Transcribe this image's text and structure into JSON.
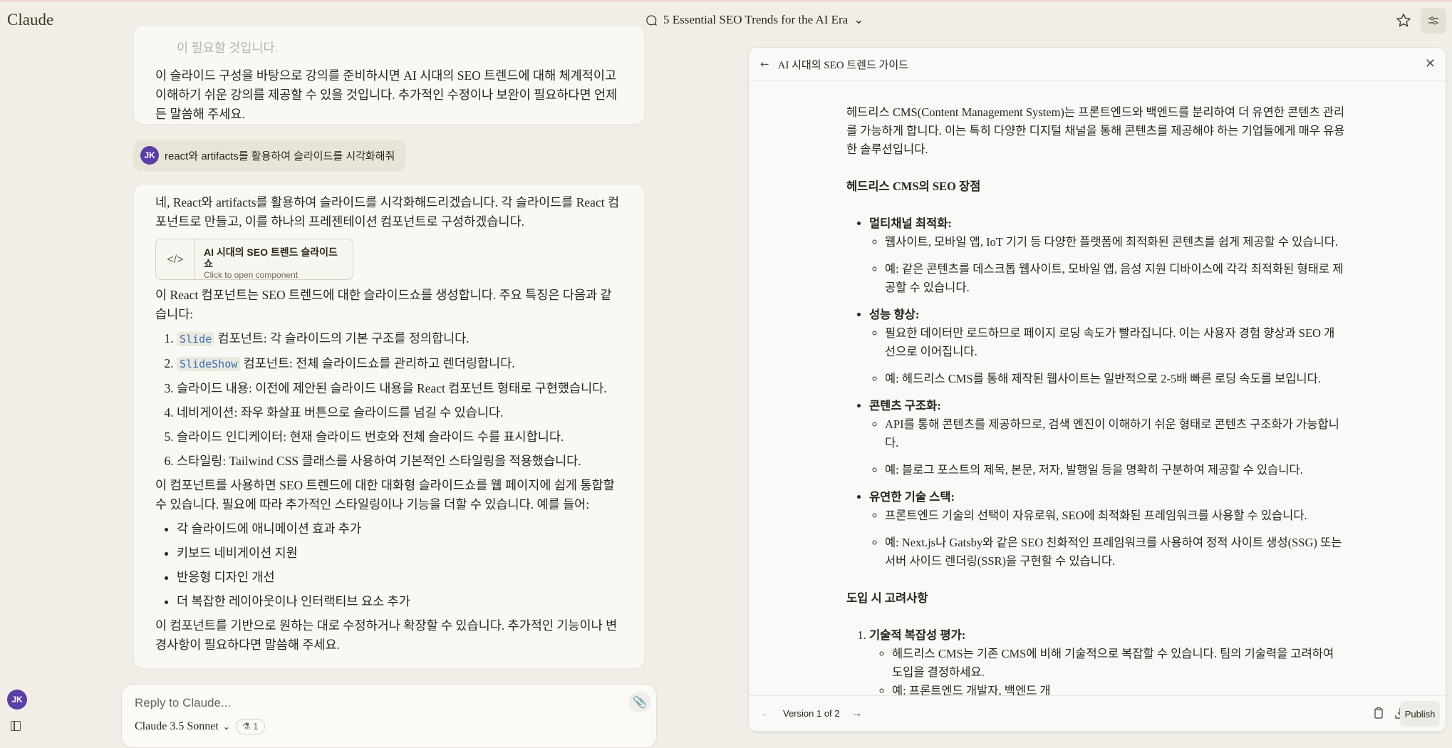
{
  "app": {
    "logo": "Claude",
    "conversation_title": "5 Essential SEO Trends for the AI Era",
    "user_initials": "JK"
  },
  "chat": {
    "prev_faded": "이 필요할 것입니다.",
    "prev_text": "이 슬라이드 구성을 바탕으로 강의를 준비하시면 AI 시대의 SEO 트렌드에 대해 체계적이고 이해하기 쉬운 강의를 제공할 수 있을 것입니다. 추가적인 수정이나 보완이 필요하다면 언제든 말씀해 주세요.",
    "user_message": "react와 artifacts를 활용하여 슬라이드를 시각화해줘",
    "reply_intro": "네, React와 artifacts를 활용하여 슬라이드를 시각화해드리겠습니다. 각 슬라이드를 React 컴포넌트로 만들고, 이를 하나의 프레젠테이션 컴포넌트로 구성하겠습니다.",
    "artifact": {
      "title": "AI 시대의 SEO 트렌드 슬라이드쇼",
      "subtitle": "Click to open component"
    },
    "features_intro": "이 React 컴포넌트는 SEO 트렌드에 대한 슬라이드쇼를 생성합니다. 주요 특징은 다음과 같습니다:",
    "features": [
      {
        "code": "Slide",
        "text": " 컴포넌트: 각 슬라이드의 기본 구조를 정의합니다."
      },
      {
        "code": "SlideShow",
        "text": " 컴포넌트: 전체 슬라이드쇼를 관리하고 렌더링합니다."
      },
      {
        "code": "",
        "text": "슬라이드 내용: 이전에 제안된 슬라이드 내용을 React 컴포넌트 형태로 구현했습니다."
      },
      {
        "code": "",
        "text": "네비게이션: 좌우 화살표 버튼으로 슬라이드를 넘길 수 있습니다."
      },
      {
        "code": "",
        "text": "슬라이드 인디케이터: 현재 슬라이드 번호와 전체 슬라이드 수를 표시합니다."
      },
      {
        "code": "",
        "text": "스타일링: Tailwind CSS 클래스를 사용하여 기본적인 스타일링을 적용했습니다."
      }
    ],
    "usage_text": "이 컴포넌트를 사용하면 SEO 트렌드에 대한 대화형 슬라이드쇼를 웹 페이지에 쉽게 통합할 수 있습니다. 필요에 따라 추가적인 스타일링이나 기능을 더할 수 있습니다. 예를 들어:",
    "examples": [
      "각 슬라이드에 애니메이션 효과 추가",
      "키보드 네비게이션 지원",
      "반응형 디자인 개선",
      "더 복잡한 레이아웃이나 인터랙티브 요소 추가"
    ],
    "closing": "이 컴포넌트를 기반으로 원하는 대로 수정하거나 확장할 수 있습니다. 추가적인 기능이나 변경사항이 필요하다면 말씀해 주세요."
  },
  "input": {
    "placeholder": "Reply to Claude...",
    "model": "Claude 3.5 Sonnet",
    "badge": "1"
  },
  "panel": {
    "title": "AI 시대의 SEO 트렌드 가이드",
    "intro": "헤드리스 CMS(Content Management System)는 프론트엔드와 백엔드를 분리하여 더 유연한 콘텐츠 관리를 가능하게 합니다. 이는 특히 다양한 디지털 채널을 통해 콘텐츠를 제공해야 하는 기업들에게 매우 유용한 솔루션입니다.",
    "heading1": "헤드리스 CMS의 SEO 장점",
    "advantages": [
      {
        "title": "멀티채널 최적화:",
        "items": [
          "웹사이트, 모바일 앱, IoT 기기 등 다양한 플랫폼에 최적화된 콘텐츠를 쉽게 제공할 수 있습니다.",
          "예: 같은 콘텐츠를 데스크톱 웹사이트, 모바일 앱, 음성 지원 디바이스에 각각 최적화된 형태로 제공할 수 있습니다."
        ]
      },
      {
        "title": "성능 향상:",
        "items": [
          "필요한 데이터만 로드하므로 페이지 로딩 속도가 빨라집니다. 이는 사용자 경험 향상과 SEO 개선으로 이어집니다.",
          "예: 헤드리스 CMS를 통해 제작된 웹사이트는 일반적으로 2-5배 빠른 로딩 속도를 보입니다."
        ]
      },
      {
        "title": "콘텐츠 구조화:",
        "items": [
          "API를 통해 콘텐츠를 제공하므로, 검색 엔진이 이해하기 쉬운 형태로 콘텐츠 구조화가 가능합니다.",
          "예: 블로그 포스트의 제목, 본문, 저자, 발행일 등을 명확히 구분하여 제공할 수 있습니다."
        ]
      },
      {
        "title": "유연한 기술 스택:",
        "items": [
          "프론트엔드 기술의 선택이 자유로워, SEO에 최적화된 프레임워크를 사용할 수 있습니다.",
          "예: Next.js나 Gatsby와 같은 SEO 친화적인 프레임워크를 사용하여 정적 사이트 생성(SSG) 또는 서버 사이드 렌더링(SSR)을 구현할 수 있습니다."
        ]
      }
    ],
    "heading2": "도입 시 고려사항",
    "considerations": [
      {
        "title": "기술적 복잡성 평가:",
        "items": [
          "헤드리스 CMS는 기존 CMS에 비해 기술적으로 복잡할 수 있습니다. 팀의 기술력을 고려하여 도입을 결정하세요.",
          "예: 프론트엔드 개발자, 백엔드 개"
        ]
      }
    ],
    "version": "Version 1 of 2",
    "publish": "Publish"
  }
}
